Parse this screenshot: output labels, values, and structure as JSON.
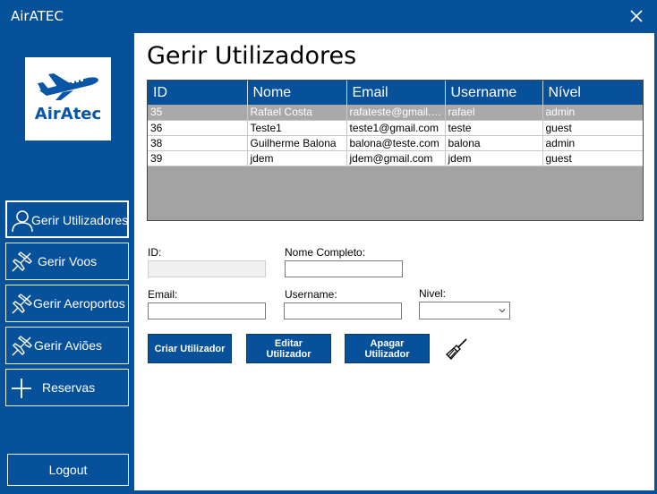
{
  "window": {
    "title": "AirATEC"
  },
  "logo": {
    "text": "AirAtec"
  },
  "sidebar": {
    "items": [
      {
        "label": "Gerir Utilizadores",
        "icon": "user-icon",
        "active": true
      },
      {
        "label": "Gerir Voos",
        "icon": "plane-icon"
      },
      {
        "label": "Gerir Aeroportos",
        "icon": "plane-icon"
      },
      {
        "label": "Gerir Aviões",
        "icon": "plane-icon"
      },
      {
        "label": "Reservas",
        "icon": "plus-icon"
      }
    ],
    "logout_label": "Logout"
  },
  "main": {
    "title": "Gerir Utilizadores",
    "table": {
      "columns": [
        "ID",
        "Nome",
        "Email",
        "Username",
        "Nível"
      ],
      "rows": [
        {
          "id": "35",
          "nome": "Rafael Costa",
          "email": "rafateste@gmail.com",
          "username": "rafael",
          "nivel": "admin",
          "selected": true
        },
        {
          "id": "36",
          "nome": "Teste1",
          "email": "teste1@gmail.com",
          "username": "teste",
          "nivel": "guest"
        },
        {
          "id": "38",
          "nome": "Guilherme Balona",
          "email": "balona@teste.com",
          "username": "balona",
          "nivel": "admin"
        },
        {
          "id": "39",
          "nome": "jdem",
          "email": "jdem@gmail.com",
          "username": "jdem",
          "nivel": "guest"
        }
      ]
    },
    "form": {
      "id_label": "ID:",
      "id_value": "",
      "nome_label": "Nome Completo:",
      "nome_value": "",
      "email_label": "Email:",
      "email_value": "",
      "username_label": "Username:",
      "username_value": "",
      "nivel_label": "Nivel:",
      "nivel_value": ""
    },
    "buttons": {
      "criar": "Criar Utilizador",
      "editar": "Editar\nUtilizador",
      "apagar": "Apagar\nUtilizador",
      "clear_icon": "broom-icon"
    }
  },
  "colors": {
    "primary": "#07509a",
    "selected_row": "#a9a9a9",
    "grid_bg": "#a3a3a3"
  }
}
